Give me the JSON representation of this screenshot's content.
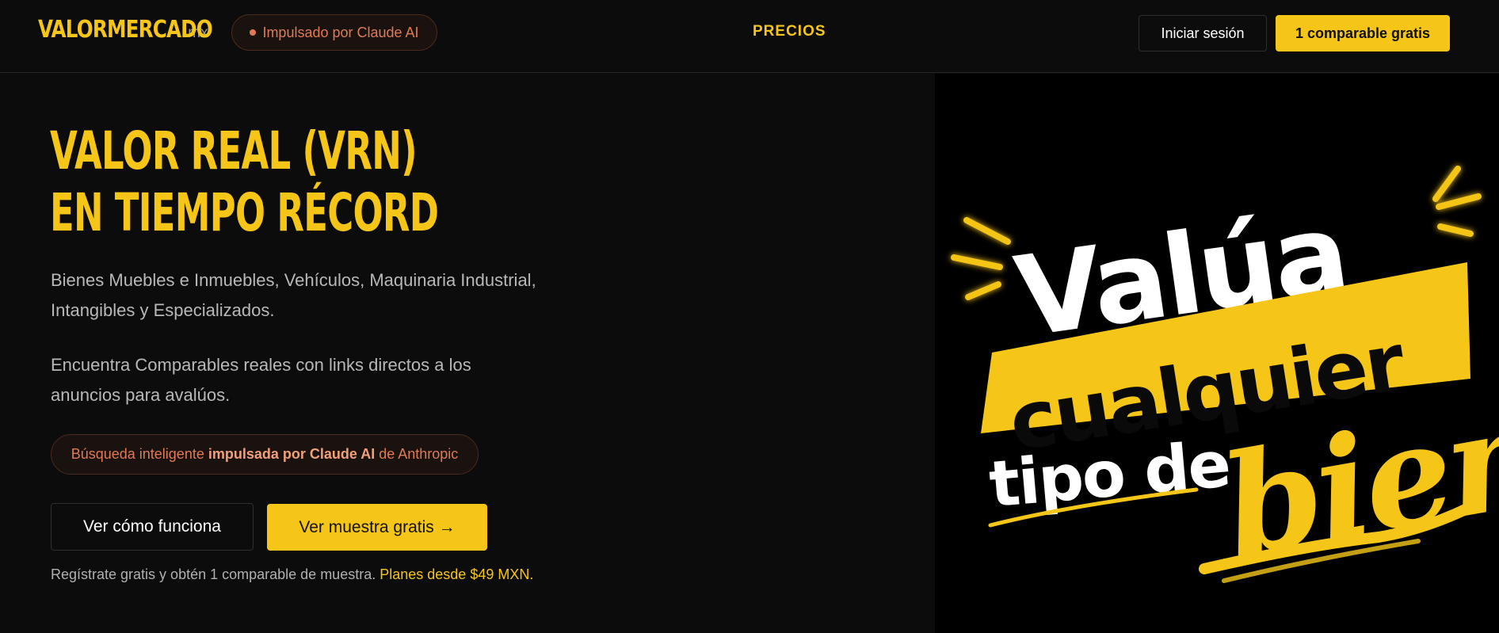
{
  "header": {
    "logo_main": "VALORMERCADO",
    "logo_tld": ".mx",
    "ai_pill": "Impulsado por Claude AI",
    "nav_precios": "PRECIOS",
    "login_label": "Iniciar sesión",
    "free_label": "1 comparable gratis"
  },
  "hero": {
    "title_line1": "VALOR REAL (VRN)",
    "title_line2": "EN TIEMPO RÉCORD",
    "paragraph1": "Bienes Muebles e Inmuebles, Vehículos, Maquinaria Industrial, Intangibles y Especializados.",
    "paragraph2": "Encuentra Comparables reales con links directos a los anuncios para avalúos.",
    "claude_pill": {
      "prefix": "Búsqueda inteligente",
      "bold": "impulsada por Claude AI",
      "suffix": "de Anthropic"
    },
    "how_button": "Ver cómo funciona",
    "sample_button": "Ver muestra gratis →",
    "footnote_text": "Regístrate gratis y obtén 1 comparable de muestra.",
    "footnote_accent": "Planes desde $49 MXN."
  },
  "art": {
    "word1": "Valúa",
    "word2": "cualquier",
    "word3": "tipo de",
    "word4": "bien"
  },
  "colors": {
    "accent": "#f5c518",
    "claude": "#e07a55",
    "background": "#0c0c0c"
  }
}
